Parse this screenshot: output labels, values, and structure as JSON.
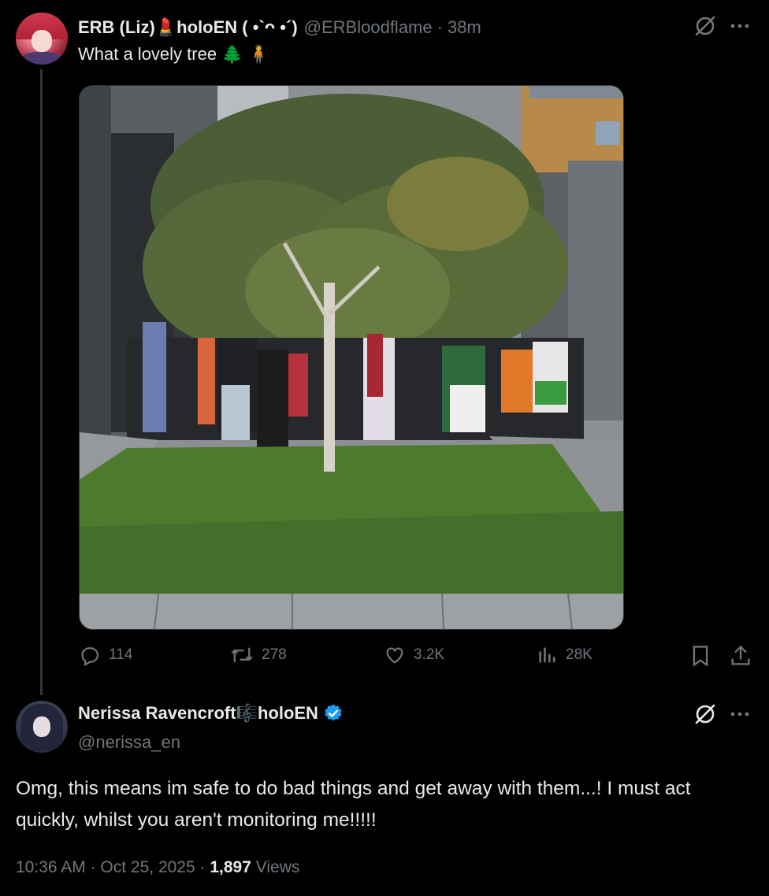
{
  "tweet1": {
    "author_name": "ERB (Liz)",
    "name_emoji": "💄",
    "name_suffix": "holoEN ( •`ᴖ •´)",
    "handle": "@ERBloodflame",
    "separator": "·",
    "time_ago": "38m",
    "text": "What a lovely tree 🌲 🧍",
    "stats": {
      "replies": "114",
      "retweets": "278",
      "likes": "3.2K",
      "views": "28K"
    }
  },
  "tweet2": {
    "author_name": "Nerissa Ravencroft",
    "name_emoji": "🎼",
    "name_suffix": "holoEN",
    "handle": "@nerissa_en",
    "text": "Omg, this means im safe to do bad things and get away with them...! I must act quickly, whilst you aren't monitoring me!!!!!",
    "time": "10:36 AM",
    "date": "Oct 25, 2025",
    "separator": "·",
    "views_count": "1,897",
    "views_label": "Views"
  },
  "colors": {
    "background": "#000000",
    "text_primary": "#e7e9ea",
    "text_secondary": "#71767b",
    "verified": "#1d9bf0"
  },
  "icons": [
    "reply-icon",
    "retweet-icon",
    "like-icon",
    "views-icon",
    "bookmark-icon",
    "share-icon",
    "grok-icon",
    "more-icon",
    "verified-badge-icon"
  ]
}
